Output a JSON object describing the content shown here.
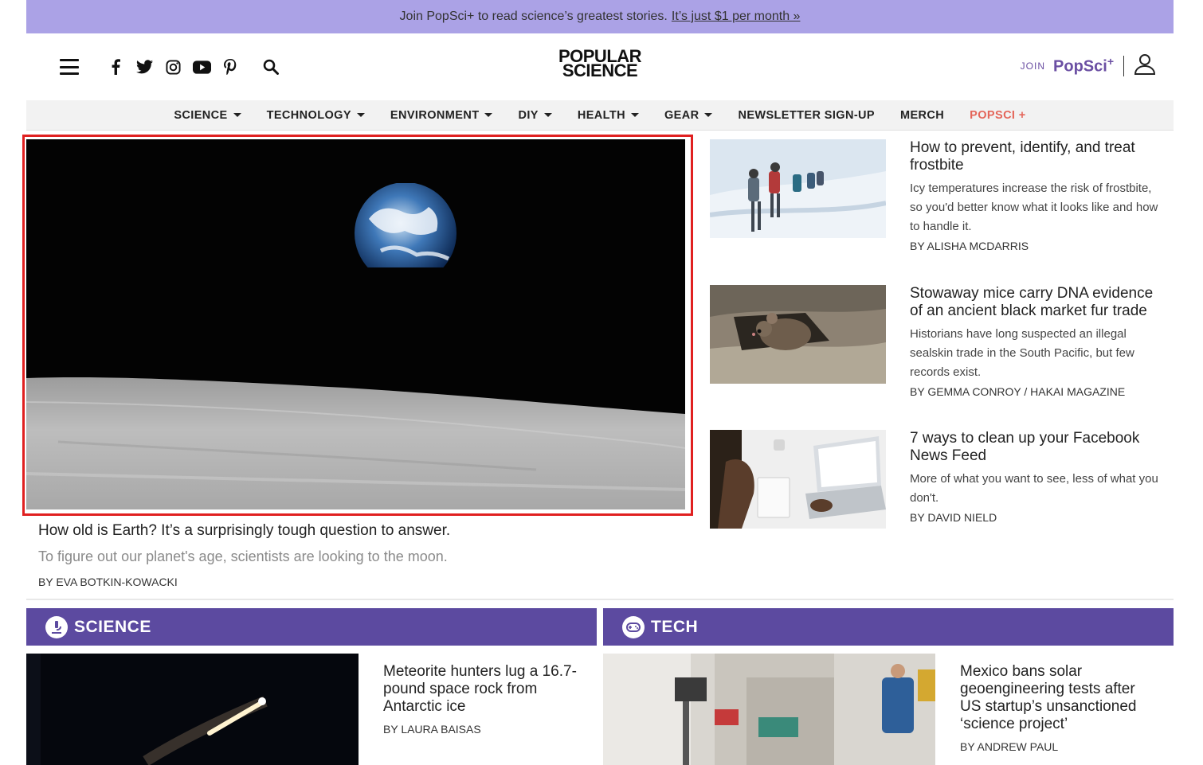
{
  "promo": {
    "text": "Join PopSci+ to read science’s greatest stories.",
    "link": "It’s just $1 per month »"
  },
  "header": {
    "logo_line1": "POPULAR",
    "logo_line2": "SCIENCE",
    "join_label": "JOIN",
    "brand_label": "PopSci",
    "brand_plus": "+"
  },
  "nav": {
    "items": [
      {
        "label": "SCIENCE"
      },
      {
        "label": "TECHNOLOGY"
      },
      {
        "label": "ENVIRONMENT"
      },
      {
        "label": "DIY"
      },
      {
        "label": "HEALTH"
      },
      {
        "label": "GEAR"
      },
      {
        "label": "NEWSLETTER SIGN-UP"
      },
      {
        "label": "MERCH"
      },
      {
        "label": "POPSCI +"
      }
    ]
  },
  "hero": {
    "title": "How old is Earth? It’s a surprisingly tough question to answer.",
    "subtitle": "To figure out our planet's age, scientists are looking to the moon.",
    "byline": "BY EVA BOTKIN-KOWACKI"
  },
  "stories": [
    {
      "title": "How to prevent, identify, and treat frostbite",
      "desc": "Icy temperatures increase the risk of frostbite, so you'd better know what it looks like and how to handle it.",
      "byline": "BY ALISHA MCDARRIS"
    },
    {
      "title": "Stowaway mice carry DNA evidence of an ancient black market fur trade",
      "desc": "Historians have long suspected an illegal sealskin trade in the South Pacific, but few records exist.",
      "byline": "BY GEMMA CONROY / HAKAI MAGAZINE"
    },
    {
      "title": "7 ways to clean up your Facebook News Feed",
      "desc": "More of what you want to see, less of what you don't.",
      "byline": "BY DAVID NIELD"
    }
  ],
  "science": {
    "label": "SCIENCE",
    "title": "Meteorite hunters lug a 16.7-pound space rock from Antarctic ice",
    "byline": "BY LAURA BAISAS"
  },
  "tech": {
    "label": "TECH",
    "title": "Mexico bans solar geoengineering tests after US startup’s unsanctioned ‘science project’",
    "byline": "BY ANDREW PAUL"
  },
  "colors": {
    "promo_bg": "#aba2e6",
    "brand_purple": "#6b4fa3",
    "section_purple": "#5c4aa0",
    "popsci_plus_nav": "#e4665a",
    "highlight_border": "#e02020"
  }
}
